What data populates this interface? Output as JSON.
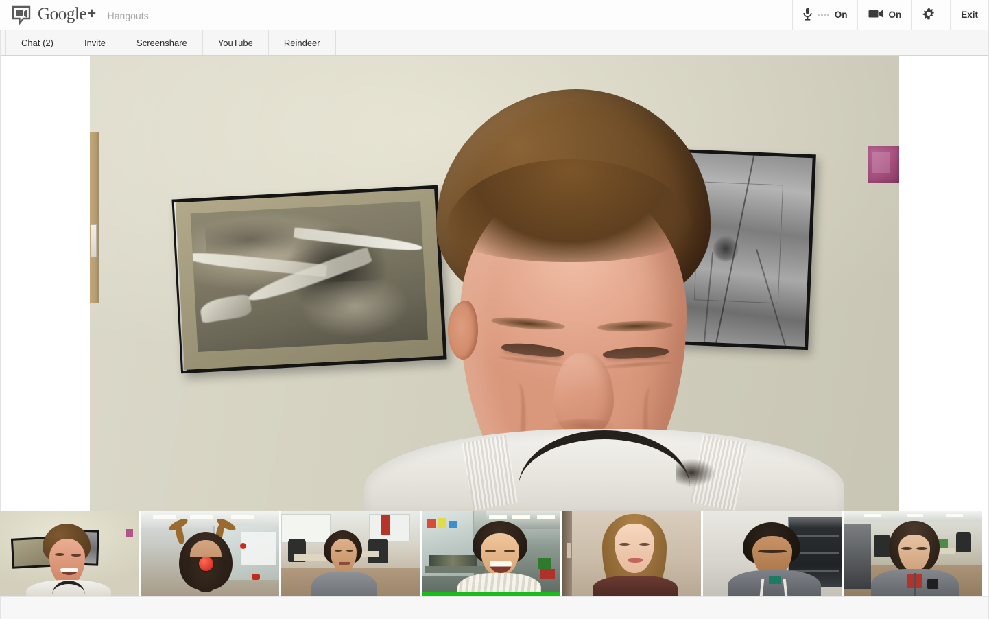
{
  "app": {
    "brand_name": "Google",
    "brand_plus": "+",
    "product": "Hangouts",
    "logo_icon": "hangouts-video-bubble-icon"
  },
  "topbar": {
    "mic": {
      "icon": "microphone-icon",
      "label": "On",
      "meter_segments": 4,
      "name": "microphone-toggle"
    },
    "camera": {
      "icon": "video-camera-icon",
      "label": "On",
      "name": "camera-toggle"
    },
    "settings": {
      "icon": "gear-icon",
      "label": "",
      "name": "settings-button"
    },
    "exit": {
      "label": "Exit",
      "name": "exit-button"
    }
  },
  "nav": {
    "items": [
      {
        "label": "Chat (2)",
        "name": "nav-item-chat"
      },
      {
        "label": "Invite",
        "name": "nav-item-invite"
      },
      {
        "label": "Screenshare",
        "name": "nav-item-screenshare"
      },
      {
        "label": "YouTube",
        "name": "nav-item-youtube"
      },
      {
        "label": "Reindeer",
        "name": "nav-item-reindeer"
      }
    ]
  },
  "stage": {
    "main_feed": {
      "name": "main-video-feed",
      "description": "Smiling man in white sweater in an office with two framed pictures on a beige wall"
    }
  },
  "filmstrip": {
    "thumbnails": [
      {
        "name": "thumbnail-participant-1",
        "selected": true,
        "speaking": false,
        "description": "Smiling man in white sweater, office wall with framed airplane picture"
      },
      {
        "name": "thumbnail-participant-2",
        "selected": false,
        "speaking": false,
        "description": "Bearded man wearing reindeer antlers and red nose in a lab"
      },
      {
        "name": "thumbnail-participant-3",
        "selected": false,
        "speaking": false,
        "description": "Man in gray button-up shirt in open office"
      },
      {
        "name": "thumbnail-participant-4",
        "selected": false,
        "speaking": true,
        "description": "Laughing man in striped shirt in a cluttered workshop"
      },
      {
        "name": "thumbnail-participant-5",
        "selected": false,
        "speaking": false,
        "description": "Woman with long hair smiling, warm indoor wall"
      },
      {
        "name": "thumbnail-participant-6",
        "selected": false,
        "speaking": false,
        "description": "Man in gray hoodie looking down, server rack behind"
      },
      {
        "name": "thumbnail-participant-7",
        "selected": false,
        "speaking": false,
        "description": "Woman in gray hoodie looking down, open office floor"
      }
    ]
  },
  "colors": {
    "accent_selected": "#3b82e0",
    "speaking_green": "#19bd19",
    "topbar_bg": "#fdfdfd",
    "navbar_bg": "#f6f6f6",
    "page_bg": "#ffffff",
    "footer_bg": "#f7f7f7",
    "text_primary": "#2b2b2b",
    "text_muted": "#a6a6a6"
  }
}
